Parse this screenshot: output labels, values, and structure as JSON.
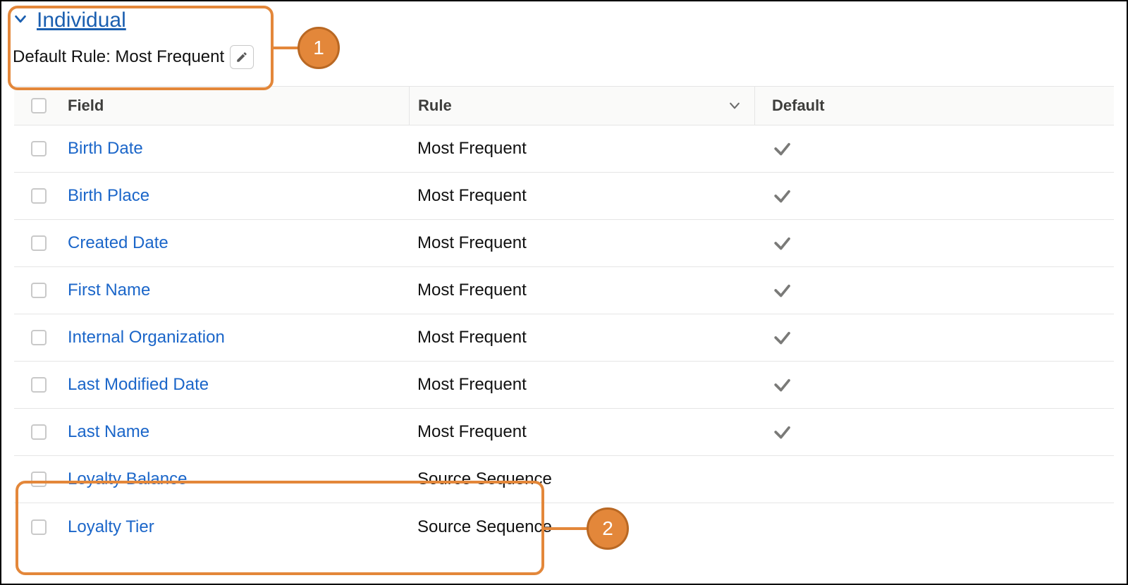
{
  "section": {
    "title": "Individual",
    "default_rule_label": "Default Rule:",
    "default_rule_value": "Most Frequent"
  },
  "table": {
    "headers": {
      "field": "Field",
      "rule": "Rule",
      "default": "Default"
    },
    "rows": [
      {
        "field": "Birth Date",
        "rule": "Most Frequent",
        "is_default": true
      },
      {
        "field": "Birth Place",
        "rule": "Most Frequent",
        "is_default": true
      },
      {
        "field": "Created Date",
        "rule": "Most Frequent",
        "is_default": true
      },
      {
        "field": "First Name",
        "rule": "Most Frequent",
        "is_default": true
      },
      {
        "field": "Internal Organization",
        "rule": "Most Frequent",
        "is_default": true
      },
      {
        "field": "Last Modified Date",
        "rule": "Most Frequent",
        "is_default": true
      },
      {
        "field": "Last Name",
        "rule": "Most Frequent",
        "is_default": true
      },
      {
        "field": "Loyalty Balance",
        "rule": "Source Sequence",
        "is_default": false
      },
      {
        "field": "Loyalty Tier",
        "rule": "Source Sequence",
        "is_default": false
      }
    ]
  },
  "callouts": {
    "one": "1",
    "two": "2"
  }
}
